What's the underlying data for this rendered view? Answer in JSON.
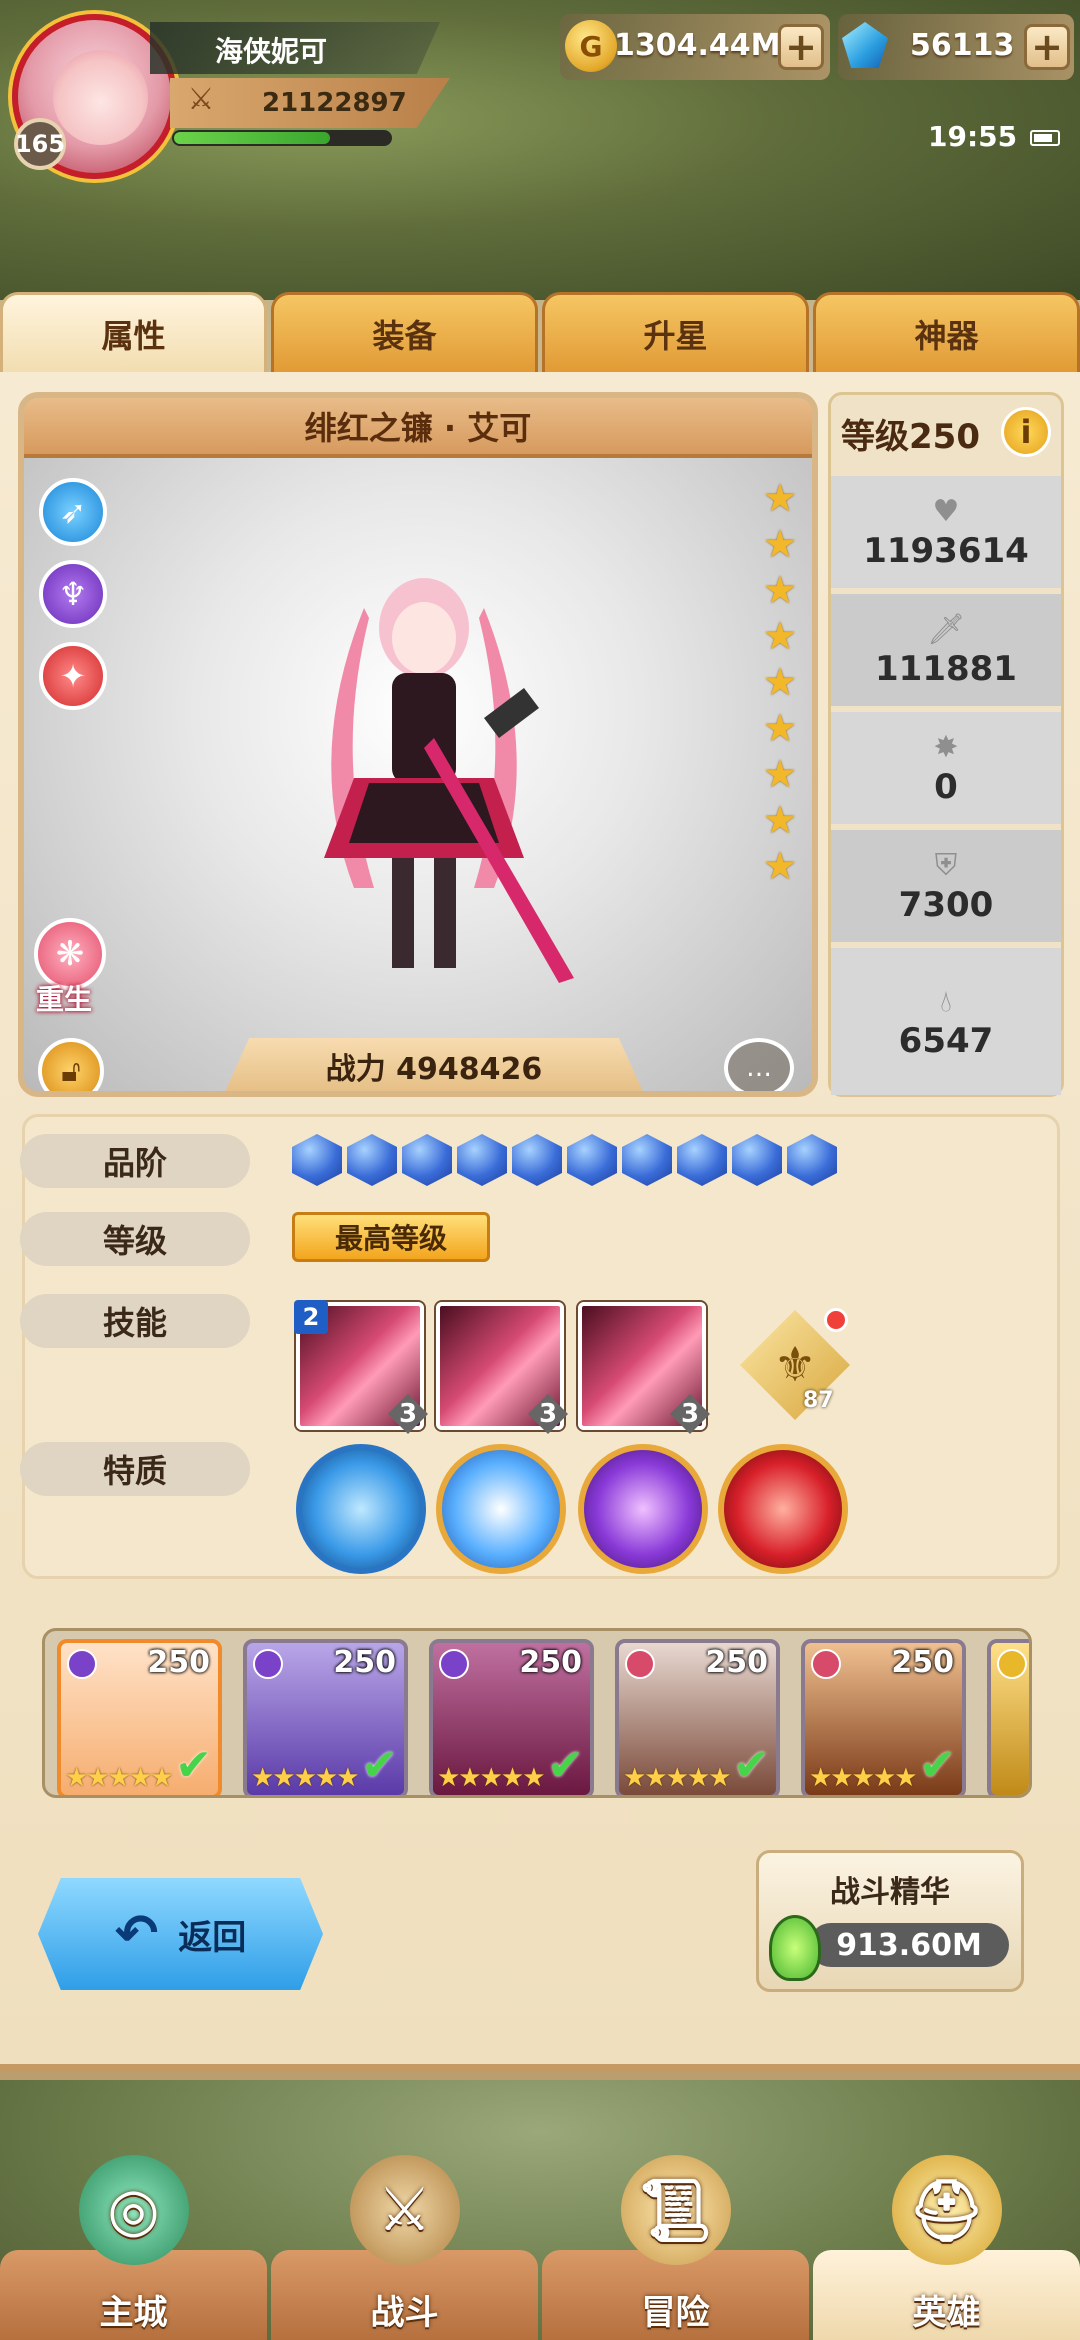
{
  "player": {
    "name": "海侠妮可",
    "level": "165",
    "power": "21122897",
    "exp_progress": 0.72
  },
  "currency": {
    "gold": "1304.44M",
    "gems": "56113"
  },
  "status": {
    "time": "19:55"
  },
  "tabs": [
    {
      "label": "属性",
      "active": true
    },
    {
      "label": "装备",
      "active": false
    },
    {
      "label": "升星",
      "active": false
    },
    {
      "label": "神器",
      "active": false
    }
  ],
  "hero": {
    "title": "绯红之镰 · 艾可",
    "combat_power": "战力 4948426",
    "stars": 9,
    "rebirth_label": "重生"
  },
  "stats": {
    "level_label": "等级250",
    "info_icon": "i",
    "rows": [
      {
        "icon": "heart-icon",
        "value": "1193614"
      },
      {
        "icon": "sword-icon",
        "value": "111881"
      },
      {
        "icon": "pin-icon",
        "value": "0"
      },
      {
        "icon": "shield-icon",
        "value": "7300"
      },
      {
        "icon": "drop-icon",
        "value": "6547"
      }
    ]
  },
  "attributes": {
    "grade_label": "品阶",
    "grade_gems": 10,
    "level_label": "等级",
    "level_badge": "最高等级",
    "skills_label": "技能",
    "skills": [
      {
        "level": "3",
        "badge": "2"
      },
      {
        "level": "3",
        "badge": ""
      },
      {
        "level": "3",
        "badge": ""
      }
    ],
    "crest_count": "87",
    "traits_label": "特质",
    "traits": [
      "#3a9ae8",
      "#5ab0ff",
      "#8a3ad8",
      "#d8202a"
    ]
  },
  "roster": [
    {
      "level": "250",
      "selected": true
    },
    {
      "level": "250",
      "selected": false
    },
    {
      "level": "250",
      "selected": false
    },
    {
      "level": "250",
      "selected": false
    },
    {
      "level": "250",
      "selected": false
    }
  ],
  "back_label": "返回",
  "essence": {
    "title": "战斗精华",
    "value": "913.60M"
  },
  "nav": [
    {
      "label": "主城",
      "active": false
    },
    {
      "label": "战斗",
      "active": false
    },
    {
      "label": "冒险",
      "active": false
    },
    {
      "label": "英雄",
      "active": true
    }
  ]
}
